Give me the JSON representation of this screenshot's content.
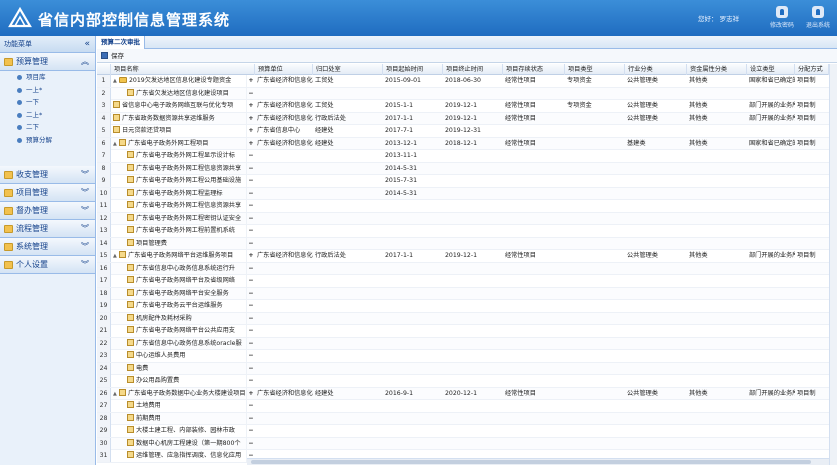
{
  "header": {
    "title": "省信内部控制信息管理系统",
    "user": "您好： 罗志祥",
    "buttons": [
      {
        "label": "修改密码",
        "icon": "lock-icon"
      },
      {
        "label": "退出系统",
        "icon": "power-icon"
      }
    ]
  },
  "sidebar": {
    "title": "功能菜单",
    "collapse_icon": "double-chevron-left-icon",
    "panels": [
      {
        "label": "预算管理",
        "expanded": true,
        "items": [
          "项目库",
          "一上*",
          "一下",
          "二上*",
          "二下",
          "预算分解"
        ]
      },
      {
        "label": "收支管理",
        "expanded": false
      },
      {
        "label": "项目管理",
        "expanded": false
      },
      {
        "label": "督办管理",
        "expanded": false
      },
      {
        "label": "流程管理",
        "expanded": false
      },
      {
        "label": "系统管理",
        "expanded": false
      },
      {
        "label": "个人设置",
        "expanded": false
      }
    ]
  },
  "tab": {
    "label": "预算二次审批"
  },
  "toolbar": {
    "save_label": "保存"
  },
  "columns": [
    "项目名称",
    "预算单位",
    "归口处室",
    "项目起始时间",
    "项目终止时间",
    "项目存续状态",
    "项目类型",
    "行业分类",
    "资金属性分类",
    "设立类型",
    "分配方式"
  ],
  "rows": [
    {
      "n": "1",
      "name": "2019欠发达地区信息化建设专题资金",
      "level": 0,
      "exp": "▲",
      "folder": true,
      "act": "+",
      "unit": "广东省经济和信息化委",
      "dept": "工贸处",
      "start": "2015-09-01",
      "end": "2018-06-30",
      "status": "经常性项目",
      "type": "专项资金",
      "ind": "公共管理类",
      "fund": "其他类",
      "est": "国家和省已确定的地方",
      "dist": "项目制"
    },
    {
      "n": "2",
      "name": "广东省欠发达地区信息化建设项目",
      "level": 1,
      "act": "−",
      "unit": "",
      "dept": "",
      "start": "",
      "end": "",
      "status": "",
      "type": "",
      "ind": "",
      "fund": "",
      "est": "",
      "dist": ""
    },
    {
      "n": "3",
      "name": "省信息中心电子政务网络互联与优化专项",
      "level": 0,
      "act": "+",
      "unit": "广东省经济和信息化委",
      "dept": "工贸处",
      "start": "2015-1-1",
      "end": "2019-12-1",
      "status": "经常性项目",
      "type": "专项资金",
      "ind": "公共管理类",
      "fund": "其他类",
      "est": "部门开展的业务所需的补",
      "dist": "项目制"
    },
    {
      "n": "4",
      "name": "广东省政务数据资源共享运维服务",
      "level": 0,
      "act": "+",
      "unit": "广东省经济和信息化委",
      "dept": "行政后法处",
      "start": "2017-1-1",
      "end": "2019-12-1",
      "status": "经常性项目",
      "type": "",
      "ind": "公共管理类",
      "fund": "其他类",
      "est": "部门开展的业务所需的补",
      "dist": "项目制"
    },
    {
      "n": "5",
      "name": "日元贷款还贷项目",
      "level": 0,
      "act": "+",
      "unit": "广东省信息中心",
      "dept": "经建处",
      "start": "2017-7-1",
      "end": "2019-12-31",
      "status": "",
      "type": "",
      "ind": "",
      "fund": "",
      "est": "",
      "dist": ""
    },
    {
      "n": "6",
      "name": "广东省电子政务外网工程项目",
      "level": 0,
      "exp": "▲",
      "act": "+",
      "unit": "广东省经济和信息化委",
      "dept": "经建处",
      "start": "2013-12-1",
      "end": "2018-12-1",
      "status": "经常性项目",
      "type": "",
      "ind": "基建类",
      "fund": "其他类",
      "est": "国家和省已确定的地方",
      "dist": "项目制"
    },
    {
      "n": "7",
      "name": "广东省电子政务外网工程显示设计标",
      "level": 1,
      "act": "−",
      "unit": "",
      "dept": "",
      "start": "2013-11-1",
      "end": "",
      "status": "",
      "type": "",
      "ind": "",
      "fund": "",
      "est": "",
      "dist": ""
    },
    {
      "n": "8",
      "name": "广东省电子政务外网工程信息资源共享",
      "level": 1,
      "act": "−",
      "unit": "",
      "dept": "",
      "start": "2014-5-31",
      "end": "",
      "status": "",
      "type": "",
      "ind": "",
      "fund": "",
      "est": "",
      "dist": ""
    },
    {
      "n": "9",
      "name": "广东省电子政务外网工程公用基础设施",
      "level": 1,
      "act": "−",
      "unit": "",
      "dept": "",
      "start": "2015-7-31",
      "end": "",
      "status": "",
      "type": "",
      "ind": "",
      "fund": "",
      "est": "",
      "dist": ""
    },
    {
      "n": "10",
      "name": "广东省电子政务外网工程监理标",
      "level": 1,
      "act": "−",
      "unit": "",
      "dept": "",
      "start": "2014-5-31",
      "end": "",
      "status": "",
      "type": "",
      "ind": "",
      "fund": "",
      "est": "",
      "dist": ""
    },
    {
      "n": "11",
      "name": "广东省电子政务外网工程信息资源共享",
      "level": 1,
      "act": "−",
      "unit": "",
      "dept": "",
      "start": "",
      "end": "",
      "status": "",
      "type": "",
      "ind": "",
      "fund": "",
      "est": "",
      "dist": ""
    },
    {
      "n": "12",
      "name": "广东省电子政务外网工程密钥认证安全",
      "level": 1,
      "act": "−",
      "unit": "",
      "dept": "",
      "start": "",
      "end": "",
      "status": "",
      "type": "",
      "ind": "",
      "fund": "",
      "est": "",
      "dist": ""
    },
    {
      "n": "13",
      "name": "广东省电子政务外网工程前置机系统",
      "level": 1,
      "act": "−",
      "unit": "",
      "dept": "",
      "start": "",
      "end": "",
      "status": "",
      "type": "",
      "ind": "",
      "fund": "",
      "est": "",
      "dist": ""
    },
    {
      "n": "14",
      "name": "项目管理费",
      "level": 1,
      "act": "−",
      "unit": "",
      "dept": "",
      "start": "",
      "end": "",
      "status": "",
      "type": "",
      "ind": "",
      "fund": "",
      "est": "",
      "dist": ""
    },
    {
      "n": "15",
      "name": "广东省电子政务网络平台运维服务项目",
      "level": 0,
      "exp": "▲",
      "act": "+",
      "unit": "广东省经济和信息化委",
      "dept": "行政后法处",
      "start": "2017-1-1",
      "end": "2019-12-1",
      "status": "经常性项目",
      "type": "",
      "ind": "公共管理类",
      "fund": "其他类",
      "est": "部门开展的业务所需的补",
      "dist": "项目制"
    },
    {
      "n": "16",
      "name": "广东省信息中心政务信息系统运行升",
      "level": 1,
      "act": "−",
      "unit": "",
      "dept": "",
      "start": "",
      "end": "",
      "status": "",
      "type": "",
      "ind": "",
      "fund": "",
      "est": "",
      "dist": ""
    },
    {
      "n": "17",
      "name": "广东省电子政务网络平台及省级网络",
      "level": 1,
      "act": "−",
      "unit": "",
      "dept": "",
      "start": "",
      "end": "",
      "status": "",
      "type": "",
      "ind": "",
      "fund": "",
      "est": "",
      "dist": ""
    },
    {
      "n": "18",
      "name": "广东省电子政务网络平台安全服务",
      "level": 1,
      "act": "−",
      "unit": "",
      "dept": "",
      "start": "",
      "end": "",
      "status": "",
      "type": "",
      "ind": "",
      "fund": "",
      "est": "",
      "dist": ""
    },
    {
      "n": "19",
      "name": "广东省电子政务云平台运维服务",
      "level": 1,
      "act": "−",
      "unit": "",
      "dept": "",
      "start": "",
      "end": "",
      "status": "",
      "type": "",
      "ind": "",
      "fund": "",
      "est": "",
      "dist": ""
    },
    {
      "n": "20",
      "name": "机房配件及耗材采购",
      "level": 1,
      "act": "−",
      "unit": "",
      "dept": "",
      "start": "",
      "end": "",
      "status": "",
      "type": "",
      "ind": "",
      "fund": "",
      "est": "",
      "dist": ""
    },
    {
      "n": "21",
      "name": "广东省电子政务网络平台公共应用支",
      "level": 1,
      "act": "−",
      "unit": "",
      "dept": "",
      "start": "",
      "end": "",
      "status": "",
      "type": "",
      "ind": "",
      "fund": "",
      "est": "",
      "dist": ""
    },
    {
      "n": "22",
      "name": "广东省信息中心政务信息系统oracle服",
      "level": 1,
      "act": "−",
      "unit": "",
      "dept": "",
      "start": "",
      "end": "",
      "status": "",
      "type": "",
      "ind": "",
      "fund": "",
      "est": "",
      "dist": ""
    },
    {
      "n": "23",
      "name": "中心运维人员费用",
      "level": 1,
      "act": "−",
      "unit": "",
      "dept": "",
      "start": "",
      "end": "",
      "status": "",
      "type": "",
      "ind": "",
      "fund": "",
      "est": "",
      "dist": ""
    },
    {
      "n": "24",
      "name": "电费",
      "level": 1,
      "act": "−",
      "unit": "",
      "dept": "",
      "start": "",
      "end": "",
      "status": "",
      "type": "",
      "ind": "",
      "fund": "",
      "est": "",
      "dist": ""
    },
    {
      "n": "25",
      "name": "办公用品购置费",
      "level": 1,
      "act": "−",
      "unit": "",
      "dept": "",
      "start": "",
      "end": "",
      "status": "",
      "type": "",
      "ind": "",
      "fund": "",
      "est": "",
      "dist": ""
    },
    {
      "n": "26",
      "name": "广东省电子政务数据中心业务大楼建设项目",
      "level": 0,
      "exp": "▲",
      "act": "+",
      "unit": "广东省经济和信息化委",
      "dept": "经建处",
      "start": "2016-9-1",
      "end": "2020-12-1",
      "status": "经常性项目",
      "type": "",
      "ind": "公共管理类",
      "fund": "其他类",
      "est": "部门开展的业务所需的补",
      "dist": "项目制"
    },
    {
      "n": "27",
      "name": "土地费用",
      "level": 1,
      "act": "−",
      "unit": "",
      "dept": "",
      "start": "",
      "end": "",
      "status": "",
      "type": "",
      "ind": "",
      "fund": "",
      "est": "",
      "dist": ""
    },
    {
      "n": "28",
      "name": "前期费用",
      "level": 1,
      "act": "−",
      "unit": "",
      "dept": "",
      "start": "",
      "end": "",
      "status": "",
      "type": "",
      "ind": "",
      "fund": "",
      "est": "",
      "dist": ""
    },
    {
      "n": "29",
      "name": "大楼土建工程、内部装修、园林市政",
      "level": 1,
      "act": "−",
      "unit": "",
      "dept": "",
      "start": "",
      "end": "",
      "status": "",
      "type": "",
      "ind": "",
      "fund": "",
      "est": "",
      "dist": ""
    },
    {
      "n": "30",
      "name": "数据中心机房工程建设（第一期800个",
      "level": 1,
      "act": "−",
      "unit": "",
      "dept": "",
      "start": "",
      "end": "",
      "status": "",
      "type": "",
      "ind": "",
      "fund": "",
      "est": "",
      "dist": ""
    },
    {
      "n": "31",
      "name": "运维管理、应急指挥调度、信息化应用",
      "level": 1,
      "act": "−",
      "unit": "",
      "dept": "",
      "start": "",
      "end": "",
      "status": "",
      "type": "",
      "ind": "",
      "fund": "",
      "est": "",
      "dist": ""
    }
  ]
}
